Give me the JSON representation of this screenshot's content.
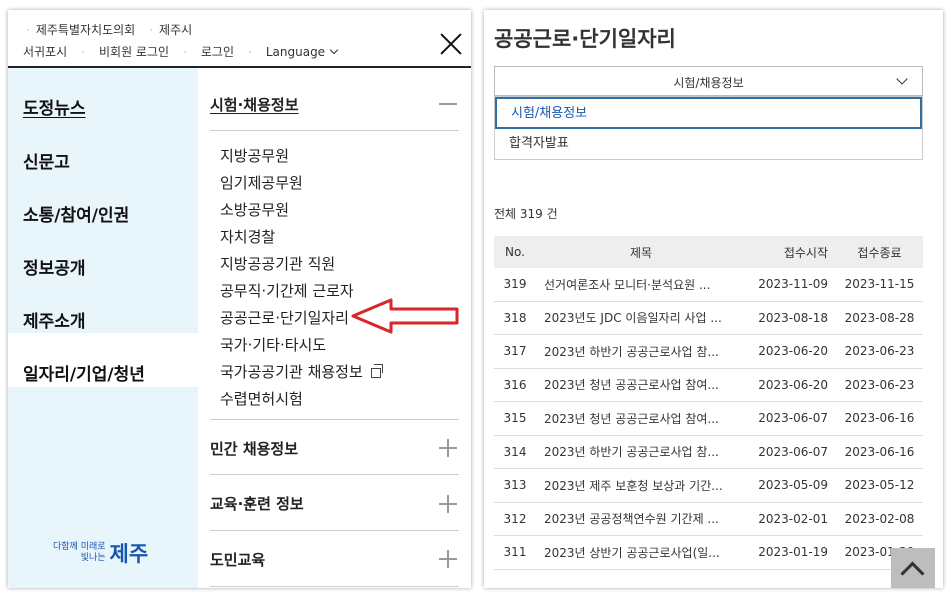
{
  "top_links": {
    "row1": [
      "제주특별자치도의회",
      "제주시"
    ],
    "row2": [
      "서귀포시",
      "비회원 로그인",
      "로그인",
      "Language"
    ]
  },
  "nav": {
    "items": [
      "도정뉴스",
      "신문고",
      "소통/참여/인권",
      "정보공개",
      "제주소개",
      "일자리/기업/청년"
    ],
    "logo_small_line1": "다함께 미래로",
    "logo_small_line2": "빛나는",
    "logo_big": "제주"
  },
  "submenu": {
    "sections": [
      "시험·채용정보",
      "민간 채용정보",
      "교육·훈련 정보",
      "도민교육"
    ],
    "items": [
      "지방공무원",
      "임기제공무원",
      "소방공무원",
      "자치경찰",
      "지방공공기관 직원",
      "공무직·기간제 근로자",
      "공공근로·단기일자리",
      "국가·기타·타시도",
      "국가공공기관 채용정보",
      "수렵면허시험"
    ]
  },
  "right": {
    "title": "공공근로·단기일자리",
    "select_value": "시험/채용정보",
    "options": [
      "시험/채용정보",
      "합격자발표"
    ],
    "total": "전체 319 건",
    "headers": [
      "No.",
      "제목",
      "접수시작",
      "접수종료"
    ],
    "rows": [
      [
        "319",
        "선거여론조사 모니터·분석요원 ...",
        "2023-11-09",
        "2023-11-15"
      ],
      [
        "318",
        "2023년도 JDC 이음일자리 사업 ...",
        "2023-08-18",
        "2023-08-28"
      ],
      [
        "317",
        "2023년 하반기 공공근로사업 참...",
        "2023-06-20",
        "2023-06-23"
      ],
      [
        "316",
        "2023년 청년 공공근로사업 참여...",
        "2023-06-20",
        "2023-06-23"
      ],
      [
        "315",
        "2023년 청년 공공근로사업 참여...",
        "2023-06-07",
        "2023-06-16"
      ],
      [
        "314",
        "2023년 하반기 공공근로사업 참...",
        "2023-06-07",
        "2023-06-16"
      ],
      [
        "313",
        "2023년 제주 보훈청 보상과 기간...",
        "2023-05-09",
        "2023-05-12"
      ],
      [
        "312",
        "2023년 공공정책연수원 기간제 ...",
        "2023-02-01",
        "2023-02-08"
      ],
      [
        "311",
        "2023년 상반기 공공근로사업(일...",
        "2023-01-19",
        "2023-01-30"
      ]
    ]
  },
  "colors": {
    "accent": "#1a56b0",
    "nav_bg": "#e8f5fb",
    "arrow": "#d9262b"
  }
}
